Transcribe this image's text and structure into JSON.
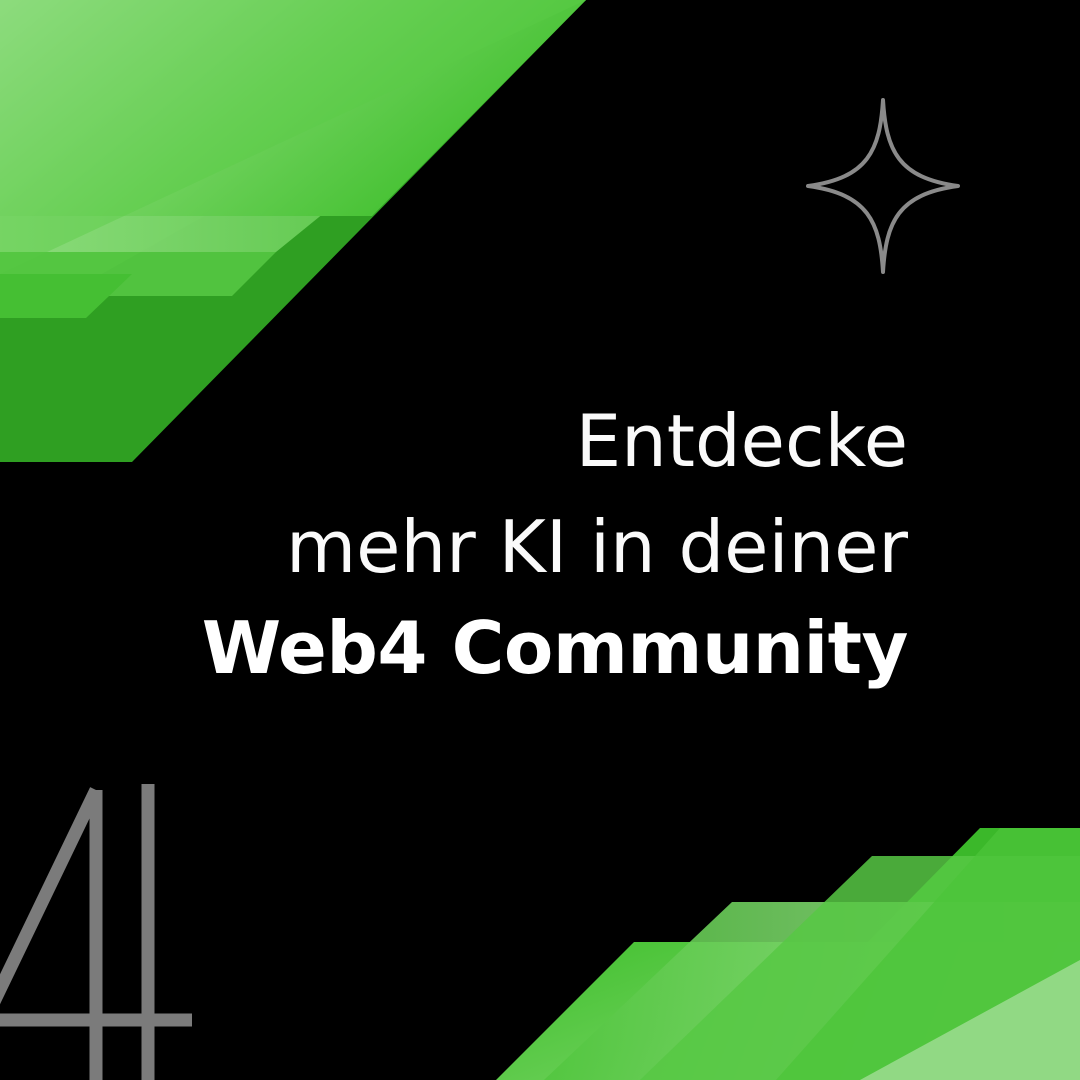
{
  "colors": {
    "background": "#000000",
    "accent_green": "#4cc43a",
    "accent_green_light": "#a8e39b",
    "text": "#ffffff",
    "sparkle_stroke": "#8a8a8a",
    "logo_gray": "#7a7a7a"
  },
  "headline": {
    "line1": "Entdecke",
    "line2": "mehr KI in deiner",
    "line3": "Web4 Community"
  },
  "icons": {
    "sparkle": "four-point-star-icon",
    "logo": "web4-logo-icon"
  }
}
